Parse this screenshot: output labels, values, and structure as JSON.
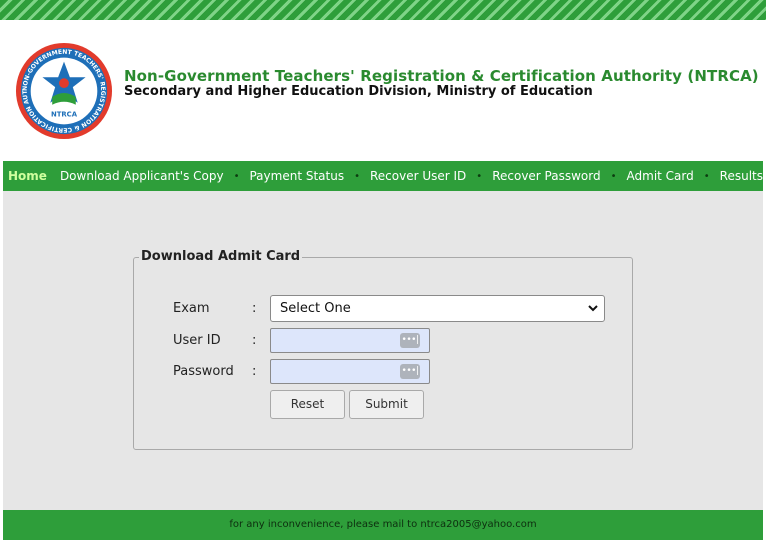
{
  "header": {
    "title": "Non-Government Teachers' Registration & Certification Authority (NTRCA)",
    "subtitle": "Secondary and Higher Education Division, Ministry of Education",
    "logo_text": "NTRCA",
    "logo_ring_text": "NON-GOVERNMENT TEACHERS' REGISTRATION & CERTIFICATION AUTHORITY"
  },
  "nav": {
    "home": "Home",
    "items": [
      "Download Applicant's Copy",
      "Payment Status",
      "Recover User ID",
      "Recover Password",
      "Admit Card",
      "Results"
    ],
    "separator": "•"
  },
  "form": {
    "legend": "Download Admit Card",
    "exam_label": "Exam",
    "user_label": "User ID",
    "password_label": "Password",
    "colon": ":",
    "exam_selected": "Select One",
    "user_value": "",
    "password_value": "",
    "password_manager_glyph": "•••|",
    "reset_label": "Reset",
    "submit_label": "Submit"
  },
  "footer": {
    "text": "for any inconvenience, please mail to ntrca2005@yahoo.com"
  },
  "colors": {
    "brand_green": "#2e9e3a",
    "title_green": "#2a8a2f",
    "home_highlight": "#cfff9e",
    "logo_red": "#e23b2c",
    "logo_blue": "#1e6fb8",
    "input_fill": "#dde6fb"
  }
}
